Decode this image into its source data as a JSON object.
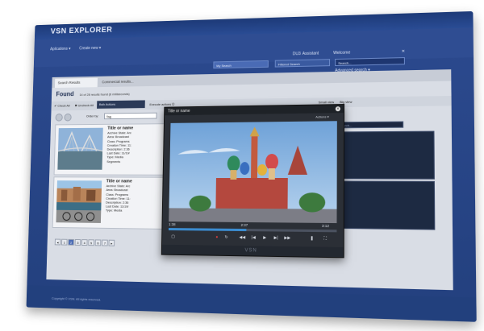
{
  "app": {
    "brand": "VSN EXPLORER"
  },
  "menu": {
    "applications": "Aplications ▾",
    "create_new": "Create new ▾"
  },
  "user": {
    "code": "DU3",
    "assistant": "Assistant",
    "welcome": "Welcome"
  },
  "search": {
    "my_search": "My Search",
    "filtered": "Filtered Search",
    "search_placeholder": "Search...",
    "advanced": "Advanced search ▾"
  },
  "tabs": [
    {
      "label": "Search Results"
    },
    {
      "label": "Commercial results..."
    }
  ],
  "found": {
    "title": "Found",
    "subtitle": "14 of 28 results found (6 milliseconds)"
  },
  "toolbar": {
    "check_all": "Check All",
    "uncheck_all": "Uncheck All",
    "bulk_actions": "Bulk Actions",
    "execute_actions": "Execute actions",
    "small_view": "Small view",
    "big_view": "Big view"
  },
  "order": {
    "label": "Order by:",
    "value": "Tag"
  },
  "results": [
    {
      "title": "Title or name",
      "lines": [
        "Archive State: Arc",
        "Area: Broadcast",
        "Class: Programs",
        "Creation Time: 11:",
        "Description: 2:36",
        "Last Date: 11/19/",
        "Type: Media"
      ],
      "extra": "Segments"
    },
    {
      "title": "Title or name",
      "lines": [
        "Archive State: Arc",
        "Area: Broadcast",
        "Class: Programs",
        "Creation Time: 11:",
        "Description: 2:36",
        "Last Date: 11/19/",
        "Type: Media"
      ],
      "extra": ""
    }
  ],
  "pagination": {
    "prev": "◂",
    "pages": [
      "1",
      "2",
      "3",
      "4",
      "5",
      "6",
      "7"
    ],
    "next": "▸",
    "selected": "2"
  },
  "right_search": {
    "placeholder": "Search..."
  },
  "player": {
    "title": "Title or name",
    "actions": "Actions ▾",
    "time_current": "1:38",
    "time_mid": "2:37",
    "time_end": "3:12",
    "progress": 0.47,
    "brand": "VSN"
  },
  "footer": {
    "text": "Copyright © VSN. All rights reserved."
  },
  "colors": {
    "accent": "#2f4d92",
    "player_bg": "#2b2f36",
    "progress": "#3b8cd0"
  }
}
